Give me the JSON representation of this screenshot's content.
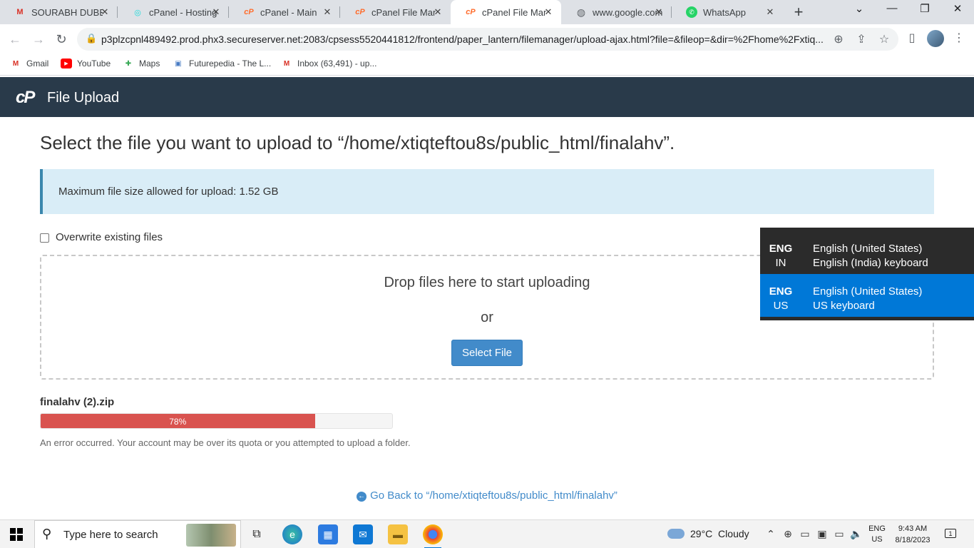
{
  "browser": {
    "tabs": [
      {
        "title": "SOURABH DUBEY",
        "favicon": "gmail-icon",
        "active": false
      },
      {
        "title": "cPanel - Hosting",
        "favicon": "godaddy-icon",
        "active": false
      },
      {
        "title": "cPanel - Main",
        "favicon": "cpanel-icon",
        "active": false
      },
      {
        "title": "cPanel File Manager",
        "favicon": "cpanel-icon",
        "active": false
      },
      {
        "title": "cPanel File Manager",
        "favicon": "cpanel-icon",
        "active": true
      },
      {
        "title": "www.google.com",
        "favicon": "globe-icon",
        "active": false
      },
      {
        "title": "WhatsApp",
        "favicon": "whatsapp-icon",
        "active": false
      }
    ],
    "url": "p3plzcpnl489492.prod.phx3.secureserver.net:2083/cpsess5520441812/frontend/paper_lantern/filemanager/upload-ajax.html?file=&fileop=&dir=%2Fhome%2Fxtiq...",
    "bookmarks": [
      {
        "label": "Gmail",
        "icon": "gmail-icon"
      },
      {
        "label": "YouTube",
        "icon": "youtube-icon"
      },
      {
        "label": "Maps",
        "icon": "maps-icon"
      },
      {
        "label": "Futurepedia - The L...",
        "icon": "futurepedia-icon"
      },
      {
        "label": "Inbox (63,491) - up...",
        "icon": "gmail-icon"
      }
    ]
  },
  "header": {
    "logo": "cP",
    "title": "File Upload"
  },
  "main": {
    "heading": "Select the file you want to upload to “/home/xtiqteftou8s/public_html/finalahv”.",
    "info": "Maximum file size allowed for upload: 1.52 GB",
    "overwrite_label": "Overwrite existing files",
    "overwrite_checked": false,
    "drop_text": "Drop files here to start uploading",
    "or_text": "or",
    "select_button": "Select File",
    "upload": {
      "filename": "finalahv (2).zip",
      "progress": 0.78,
      "progress_label": "78%",
      "error": "An error occurred. Your account may be over its quota or you attempted to upload a folder."
    },
    "go_back": "Go Back to “/home/xtiqteftou8s/public_html/finalahv”"
  },
  "language_popup": [
    {
      "code1": "ENG",
      "code2": "IN",
      "line1": "English (United States)",
      "line2": "English (India) keyboard",
      "selected": false
    },
    {
      "code1": "ENG",
      "code2": "US",
      "line1": "English (United States)",
      "line2": "US keyboard",
      "selected": true
    }
  ],
  "taskbar": {
    "search_placeholder": "Type here to search",
    "weather": "29°C  Cloudy",
    "lang1": "ENG",
    "lang2": "US",
    "time": "9:43 AM",
    "date": "8/18/2023",
    "notification_count": "1"
  },
  "colors": {
    "cpanel_header": "#293a4a",
    "info_bg": "#d9edf7",
    "button_blue": "#428bca",
    "progress_error": "#d9534f",
    "lang_selected": "#0078d7"
  }
}
